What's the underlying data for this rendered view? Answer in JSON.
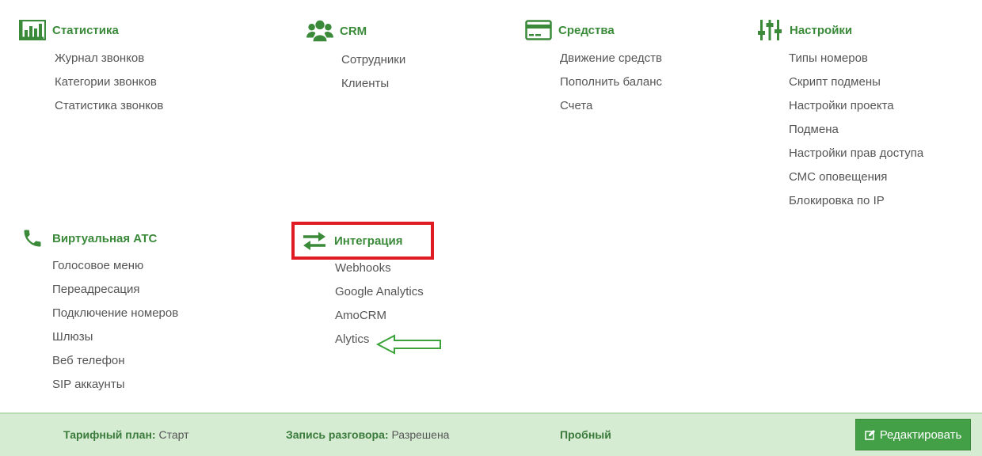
{
  "sections": {
    "stat": {
      "title": "Статистика",
      "icon": "bar-chart-icon",
      "items": [
        "Журнал звонков",
        "Категории звонков",
        "Статистика звонков"
      ]
    },
    "crm": {
      "title": "CRM",
      "icon": "users-icon",
      "items": [
        "Сотрудники",
        "Клиенты"
      ]
    },
    "fin": {
      "title": "Средства",
      "icon": "credit-card-icon",
      "items": [
        "Движение средств",
        "Пополнить баланс",
        "Счета"
      ]
    },
    "set": {
      "title": "Настройки",
      "icon": "sliders-icon",
      "items": [
        "Типы номеров",
        "Скрипт подмены",
        "Настройки проекта",
        "Подмена",
        "Настройки прав доступа",
        "СМС оповещения",
        "Блокировка по IP"
      ]
    },
    "ats": {
      "title": "Виртуальная АТС",
      "icon": "phone-icon",
      "items": [
        "Голосовое меню",
        "Переадресация",
        "Подключение номеров",
        "Шлюзы",
        "Веб телефон",
        "SIP аккаунты"
      ]
    },
    "int": {
      "title": "Интеграция",
      "icon": "exchange-icon",
      "items": [
        "Webhooks",
        "Google Analytics",
        "AmoCRM",
        "Alytics"
      ]
    }
  },
  "footer": {
    "plan_label": "Тарифный план:",
    "plan_value": "Старт",
    "rec_label": "Запись разговора:",
    "rec_value": "Разрешена",
    "trial": "Пробный",
    "edit_label": "Редактировать"
  },
  "colors": {
    "accent": "#3a8a3a",
    "highlight": "#e01b24",
    "footer_bg": "#d5ecd3",
    "button_bg": "#43a047"
  }
}
